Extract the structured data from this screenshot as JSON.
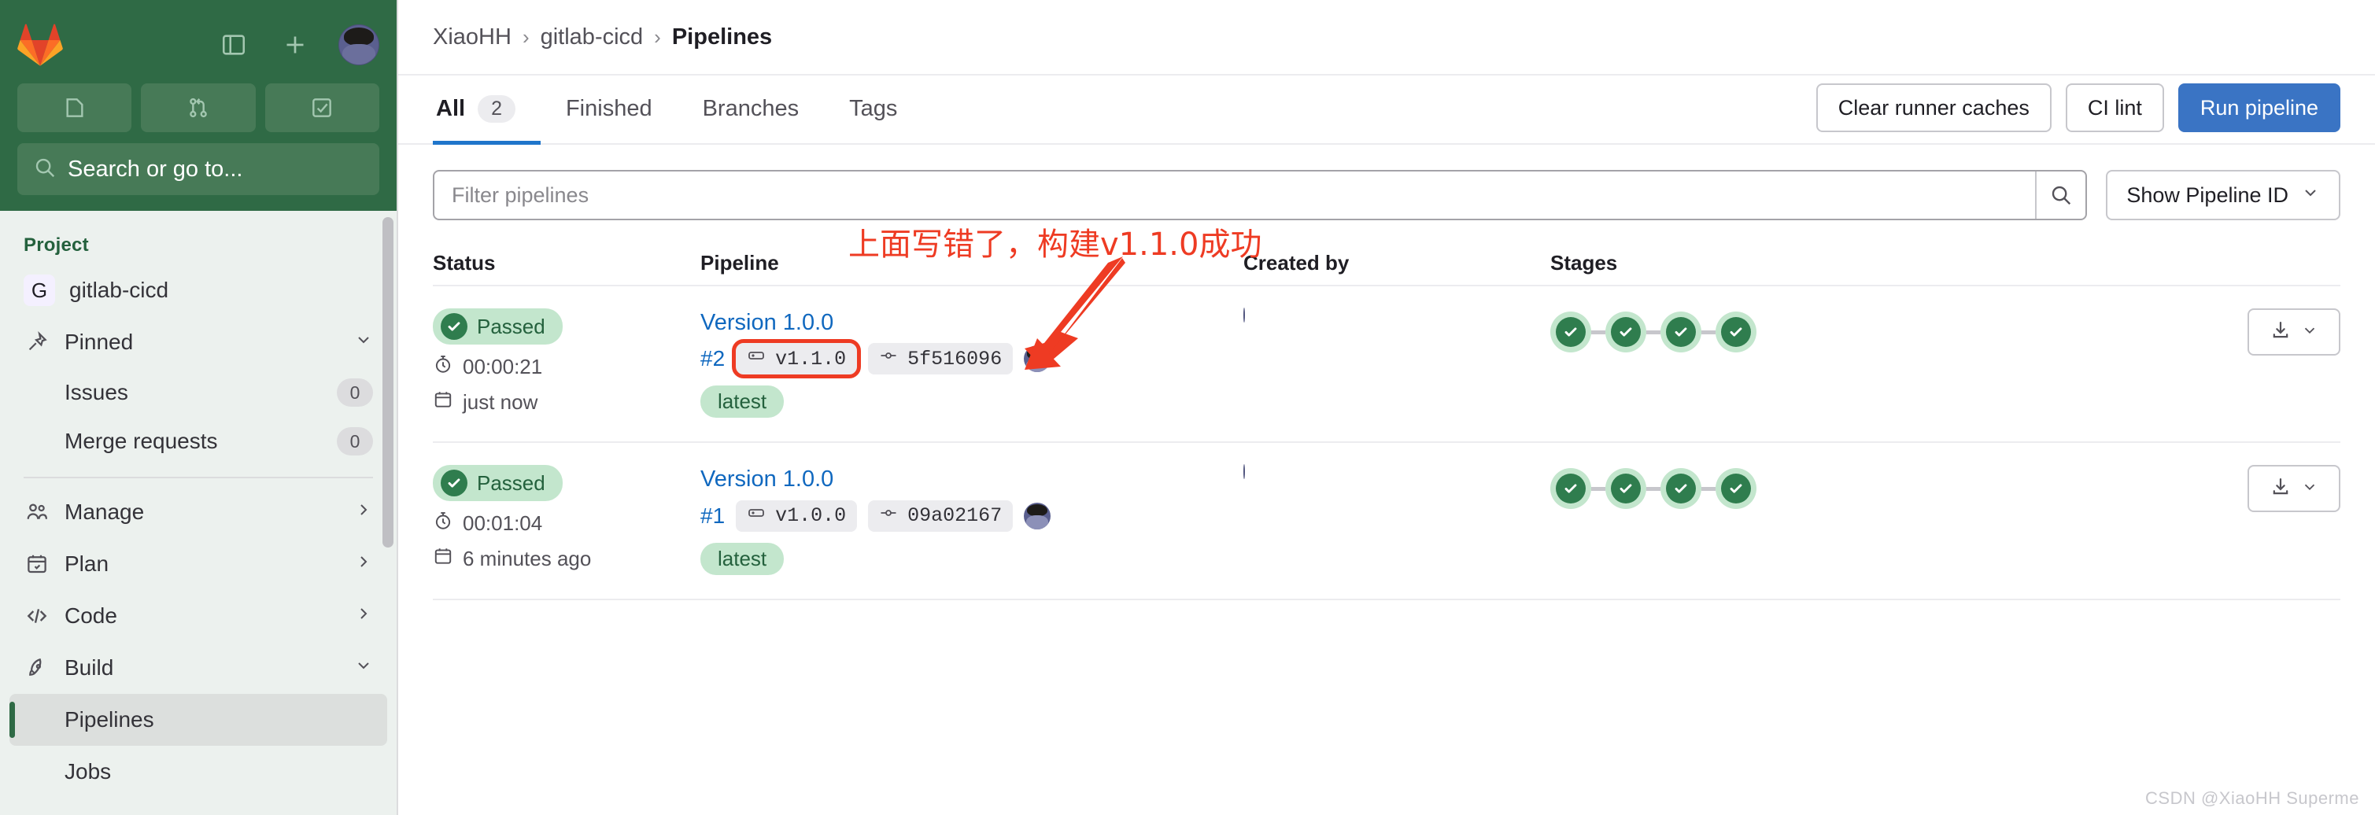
{
  "sidebar": {
    "logo": "gitlab-logo",
    "top_icons": [
      "sidebar-toggle-icon",
      "plus-icon",
      "user-avatar"
    ],
    "quick_actions": [
      {
        "name": "issue-icon",
        "label": ""
      },
      {
        "name": "merge-request-icon",
        "label": ""
      },
      {
        "name": "todo-icon",
        "label": ""
      }
    ],
    "search_placeholder": "Search or go to...",
    "section_title": "Project",
    "project": {
      "initial": "G",
      "name": "gitlab-cicd"
    },
    "items": [
      {
        "label": "Pinned",
        "icon": "pin-icon",
        "chevron": "⌄",
        "count": null,
        "indent": false,
        "active": false
      },
      {
        "label": "Issues",
        "icon": "",
        "chevron": "",
        "count": "0",
        "indent": true,
        "active": false
      },
      {
        "label": "Merge requests",
        "icon": "",
        "chevron": "",
        "count": "0",
        "indent": true,
        "active": false
      },
      {
        "label": "Manage",
        "icon": "users-icon",
        "chevron": "›",
        "count": null,
        "indent": false,
        "active": false
      },
      {
        "label": "Plan",
        "icon": "calendar-icon",
        "chevron": "›",
        "count": null,
        "indent": false,
        "active": false
      },
      {
        "label": "Code",
        "icon": "code-icon",
        "chevron": "›",
        "count": null,
        "indent": false,
        "active": false
      },
      {
        "label": "Build",
        "icon": "rocket-icon",
        "chevron": "⌄",
        "count": null,
        "indent": false,
        "active": false
      },
      {
        "label": "Pipelines",
        "icon": "",
        "chevron": "",
        "count": null,
        "indent": true,
        "active": true
      },
      {
        "label": "Jobs",
        "icon": "",
        "chevron": "",
        "count": null,
        "indent": true,
        "active": false
      }
    ]
  },
  "breadcrumb": {
    "items": [
      "XiaoHH",
      "gitlab-cicd",
      "Pipelines"
    ],
    "separator": "›"
  },
  "tabs": [
    {
      "label": "All",
      "count": "2",
      "active": true
    },
    {
      "label": "Finished",
      "count": null,
      "active": false
    },
    {
      "label": "Branches",
      "count": null,
      "active": false
    },
    {
      "label": "Tags",
      "count": null,
      "active": false
    }
  ],
  "actions": {
    "clear_runner_caches": "Clear runner caches",
    "ci_lint": "CI lint",
    "run_pipeline": "Run pipeline"
  },
  "filter": {
    "placeholder": "Filter pipelines",
    "value": "",
    "search_icon": "search-icon",
    "show_pipeline_id": "Show Pipeline ID",
    "chevron": "⌄"
  },
  "table": {
    "headers": {
      "status": "Status",
      "pipeline": "Pipeline",
      "created_by": "Created by",
      "stages": "Stages"
    },
    "rows": [
      {
        "status": "Passed",
        "duration": "00:00:21",
        "finished": "just now",
        "name": "Version 1.0.0",
        "id": "#2",
        "ref": "v1.1.0",
        "ref_highlighted": true,
        "commit": "5f516096",
        "tag": "latest",
        "stages": [
          "passed",
          "passed",
          "passed",
          "passed"
        ]
      },
      {
        "status": "Passed",
        "duration": "00:01:04",
        "finished": "6 minutes ago",
        "name": "Version 1.0.0",
        "id": "#1",
        "ref": "v1.0.0",
        "ref_highlighted": false,
        "commit": "09a02167",
        "tag": "latest",
        "stages": [
          "passed",
          "passed",
          "passed",
          "passed"
        ]
      }
    ]
  },
  "annotation": {
    "text": "上面写错了，构建v1.1.0成功",
    "color": "#ee3b23"
  },
  "watermark": "CSDN @XiaoHH Superme",
  "colors": {
    "brand_green": "#2f6a45",
    "sidebar_bg": "#ecf1ee",
    "link_blue": "#1068bf",
    "primary_button": "#3a74c4",
    "status_green_bg": "#c3e6cd",
    "status_green_fg": "#24613d",
    "tab_underline": "#1f75cb",
    "annotation_red": "#ee3b23"
  }
}
